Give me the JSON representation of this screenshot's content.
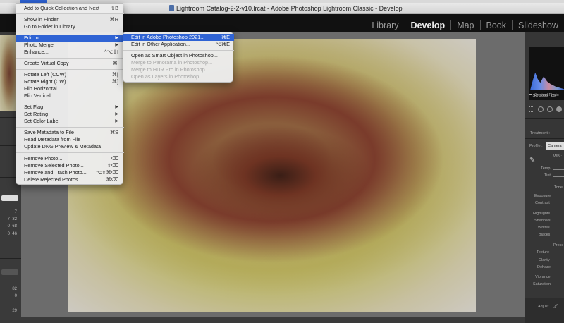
{
  "window": {
    "title": "Lightroom Catalog-2-2-v10.lrcat - Adobe Photoshop Lightroom Classic - Develop"
  },
  "modules": [
    {
      "label": "Library",
      "active": false
    },
    {
      "label": "Develop",
      "active": true
    },
    {
      "label": "Map",
      "active": false
    },
    {
      "label": "Book",
      "active": false
    },
    {
      "label": "Slideshow",
      "active": false
    }
  ],
  "photo_menu": {
    "items": [
      {
        "label": "Add to Quick Collection and Next",
        "shortcut": "⇧B"
      },
      {
        "label": "Show in Finder",
        "shortcut": "⌘R"
      },
      {
        "label": "Go to Folder in Library",
        "shortcut": ""
      },
      {
        "label": "Edit In",
        "shortcut": "",
        "submenu": true,
        "highlighted": true
      },
      {
        "label": "Photo Merge",
        "shortcut": "",
        "submenu": true
      },
      {
        "label": "Enhance...",
        "shortcut": "^⌥⇧I"
      },
      {
        "label": "Create Virtual Copy",
        "shortcut": "⌘'"
      },
      {
        "label": "Rotate Left (CCW)",
        "shortcut": "⌘["
      },
      {
        "label": "Rotate Right (CW)",
        "shortcut": "⌘]"
      },
      {
        "label": "Flip Horizontal",
        "shortcut": ""
      },
      {
        "label": "Flip Vertical",
        "shortcut": ""
      },
      {
        "label": "Set Flag",
        "shortcut": "",
        "submenu": true
      },
      {
        "label": "Set Rating",
        "shortcut": "",
        "submenu": true
      },
      {
        "label": "Set Color Label",
        "shortcut": "",
        "submenu": true
      },
      {
        "label": "Save Metadata to File",
        "shortcut": "⌘S"
      },
      {
        "label": "Read Metadata from File",
        "shortcut": ""
      },
      {
        "label": "Update DNG Preview & Metadata",
        "shortcut": ""
      },
      {
        "label": "Remove Photo...",
        "shortcut": "⌫"
      },
      {
        "label": "Remove Selected Photo...",
        "shortcut": "⇧⌫"
      },
      {
        "label": "Remove and Trash Photo...",
        "shortcut": "⌥⇧⌘⌫"
      },
      {
        "label": "Delete Rejected Photos...",
        "shortcut": "⌘⌫"
      }
    ]
  },
  "edit_in_submenu": {
    "items": [
      {
        "label": "Edit in Adobe Photoshop 2021...",
        "shortcut": "⌘E",
        "highlighted": true,
        "enabled": true
      },
      {
        "label": "Edit in Other Application...",
        "shortcut": "⌥⌘E",
        "enabled": true
      },
      {
        "label": "Open as Smart Object in Photoshop...",
        "shortcut": "",
        "enabled": true
      },
      {
        "label": "Merge to Panorama in Photoshop...",
        "shortcut": "",
        "enabled": false
      },
      {
        "label": "Merge to HDR Pro in Photoshop...",
        "shortcut": "",
        "enabled": false
      },
      {
        "label": "Open as Layers in Photoshop...",
        "shortcut": "",
        "enabled": false
      }
    ]
  },
  "left_panel": {
    "values": [
      "-7",
      "-7",
      "0",
      "0",
      "82",
      "0",
      "29"
    ],
    "values_col2": [
      "0",
      "32",
      "68",
      "46"
    ]
  },
  "right_panel": {
    "iso": "ISO 3000",
    "iso_extra": "85",
    "original_photo": "Original Photo",
    "treatment_label": "Treatment :",
    "profile_label": "Profile :",
    "profile_value": "Camera",
    "wb_label": "WB :",
    "temp_label": "Temp",
    "tint_label": "Tint",
    "tone_label": "Tone",
    "exposure_label": "Exposure",
    "contrast_label": "Contrast",
    "highlights_label": "Highlights",
    "shadows_label": "Shadows",
    "whites_label": "Whites",
    "blacks_label": "Blacks",
    "presence_label": "Prese",
    "texture_label": "Texture",
    "clarity_label": "Clarity",
    "dehaze_label": "Dehaze",
    "vibrance_label": "Vibrance",
    "saturation_label": "Saturation",
    "adjust_label": "Adjust"
  },
  "colors": {
    "menu_highlight": "#2f63d4",
    "panel_bg": "#363636",
    "canvas_bg": "#6c6c6c"
  }
}
